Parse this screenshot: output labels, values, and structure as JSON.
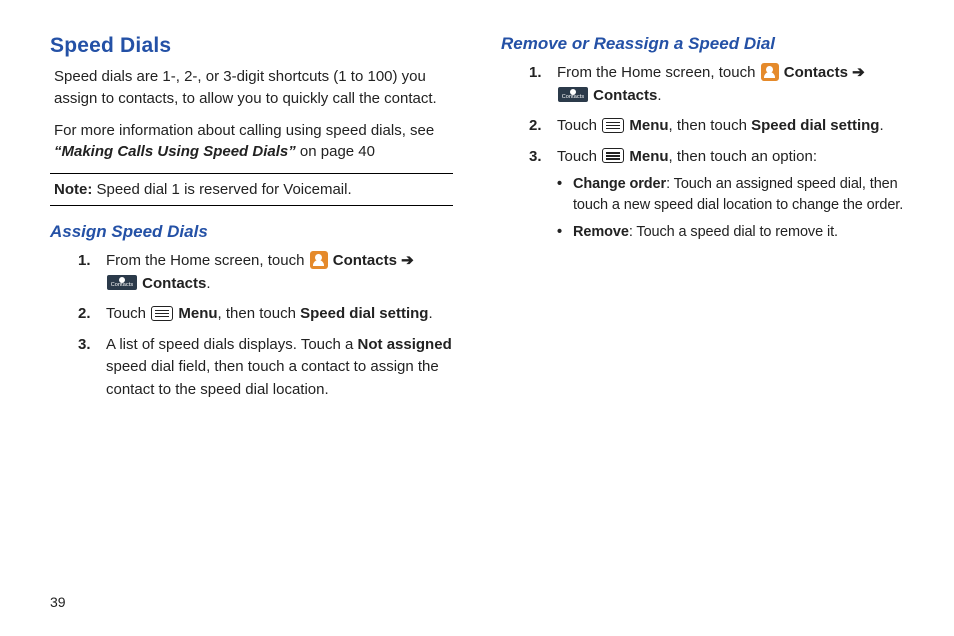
{
  "page_number": "39",
  "left": {
    "heading": "Speed Dials",
    "intro1": "Speed dials are 1-, 2-, or 3-digit shortcuts (1 to 100) you assign to contacts, to allow you to quickly call the contact.",
    "intro2_a": "For more information about calling using speed dials, see ",
    "intro2_ref": "“Making Calls Using Speed Dials”",
    "intro2_b": " on page 40",
    "note_label": "Note:",
    "note_text": " Speed dial 1 is reserved for Voicemail.",
    "sub_heading": "Assign Speed Dials",
    "step1_a": "From the Home screen, touch ",
    "step1_b": " Contacts ",
    "arrow": "➔",
    "step1_c": " Contacts",
    "step2_a": "Touch ",
    "step2_b": " Menu",
    "step2_c": ", then touch ",
    "step2_d": "Speed dial setting",
    "step3_a": "A list of speed dials displays. Touch a ",
    "step3_b": "Not assigned",
    "step3_c": " speed dial field, then touch a contact to assign the contact to the speed dial location."
  },
  "right": {
    "sub_heading": "Remove or Reassign a Speed Dial",
    "step1_a": "From the Home screen, touch ",
    "step1_b": " Contacts ",
    "arrow": "➔",
    "step1_c": " Contacts",
    "step2_a": "Touch ",
    "step2_b": " Menu",
    "step2_c": ", then touch ",
    "step2_d": "Speed dial setting",
    "step3_a": "Touch ",
    "step3_b": " Menu",
    "step3_c": ", then touch an option:",
    "bullet1_a": "Change order",
    "bullet1_b": ": Touch an assigned speed dial, then touch a new speed dial location to change the order.",
    "bullet2_a": "Remove",
    "bullet2_b": ": Touch a speed dial to remove it."
  }
}
